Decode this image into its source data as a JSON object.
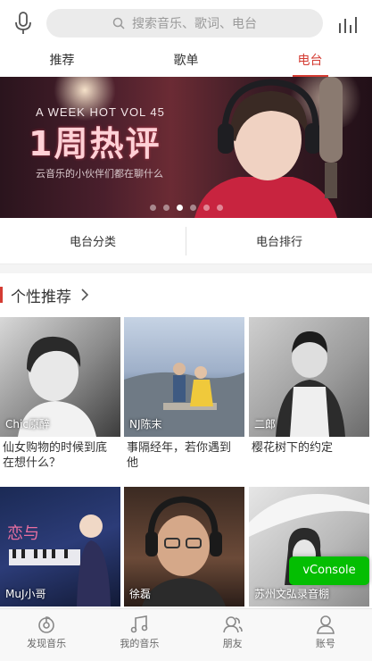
{
  "header": {
    "mic_icon": "microphone-icon",
    "search_placeholder": "搜索音乐、歌词、电台",
    "search_icon": "search-icon",
    "chart_icon": "bar-chart-icon"
  },
  "tabs": [
    {
      "label": "推荐",
      "active": false
    },
    {
      "label": "歌单",
      "active": false
    },
    {
      "label": "电台",
      "active": true
    }
  ],
  "banner": {
    "line1": "A WEEK HOT VOL 45",
    "title": "1周热评",
    "line2": "云音乐的小伙伴们都在聊什么",
    "dots": 6,
    "active_dot": 2
  },
  "categories": [
    {
      "label": "电台分类"
    },
    {
      "label": "电台排行"
    }
  ],
  "section": {
    "title": "个性推荐"
  },
  "cards": [
    {
      "nick": "Chic原醉",
      "title": "仙女购物的时候到底在想什么？"
    },
    {
      "nick": "NJ陈末",
      "title": "事隔经年，若你遇到他"
    },
    {
      "nick": "二郎",
      "title": "樱花树下的约定"
    },
    {
      "nick": "MuJ小哥",
      "title": ""
    },
    {
      "nick": "徐磊",
      "title": ""
    },
    {
      "nick": "苏州文弘录音棚",
      "title": ""
    }
  ],
  "vconsole": {
    "label": "vConsole"
  },
  "bottom_nav": [
    {
      "label": "发现音乐",
      "icon": "discover-music-icon"
    },
    {
      "label": "我的音乐",
      "icon": "music-note-icon"
    },
    {
      "label": "朋友",
      "icon": "friends-icon"
    },
    {
      "label": "账号",
      "icon": "account-icon"
    }
  ],
  "colors": {
    "accent": "#d43c33",
    "vconsole": "#04be02"
  }
}
